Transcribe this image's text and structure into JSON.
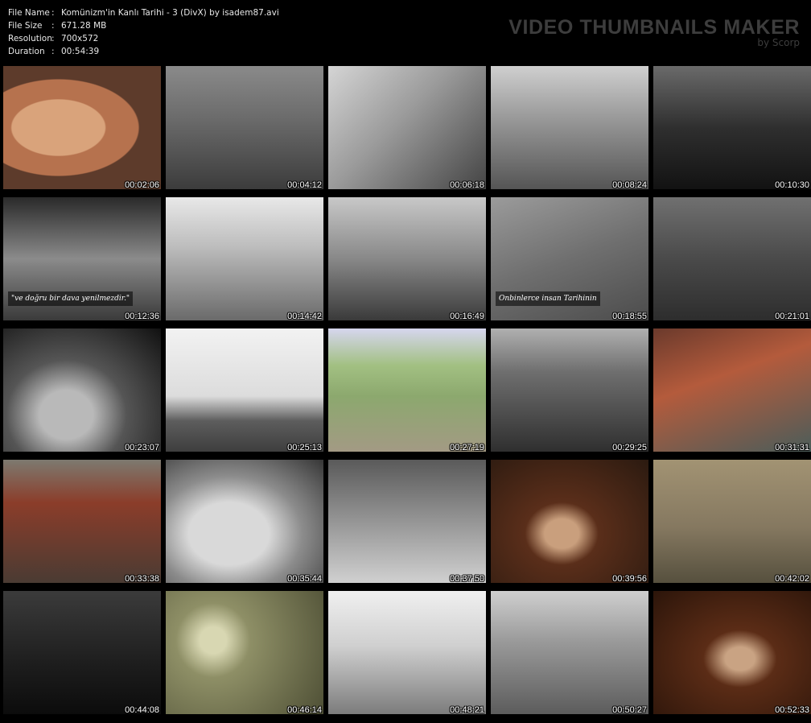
{
  "info": [
    {
      "key": "File Name",
      "sep": ":",
      "value": "Komünizm'in Kanlı Tarihi - 3 (DivX) by isadem87.avi"
    },
    {
      "key": "File Size",
      "sep": ":",
      "value": "671.28 MB"
    },
    {
      "key": "Resolution",
      "sep": ":",
      "value": "700x572"
    },
    {
      "key": "Duration",
      "sep": ":",
      "value": "00:54:39"
    }
  ],
  "brand": {
    "title": "VIDEO THUMBNAILS MAKER",
    "subtitle": "by Scorp"
  },
  "thumbnails": [
    {
      "time": "00:02:06",
      "caption": ""
    },
    {
      "time": "00:04:12",
      "caption": ""
    },
    {
      "time": "00:06:18",
      "caption": ""
    },
    {
      "time": "00:08:24",
      "caption": ""
    },
    {
      "time": "00:10:30",
      "caption": ""
    },
    {
      "time": "00:12:36",
      "caption": "\"ve doğru bir dava yenilmezdir.\""
    },
    {
      "time": "00:14:42",
      "caption": ""
    },
    {
      "time": "00:16:49",
      "caption": ""
    },
    {
      "time": "00:18:55",
      "caption": "Onbinlerce insan Tarihinin"
    },
    {
      "time": "00:21:01",
      "caption": ""
    },
    {
      "time": "00:23:07",
      "caption": ""
    },
    {
      "time": "00:25:13",
      "caption": ""
    },
    {
      "time": "00:27:19",
      "caption": ""
    },
    {
      "time": "00:29:25",
      "caption": ""
    },
    {
      "time": "00:31:31",
      "caption": ""
    },
    {
      "time": "00:33:38",
      "caption": ""
    },
    {
      "time": "00:35:44",
      "caption": ""
    },
    {
      "time": "00:37:50",
      "caption": ""
    },
    {
      "time": "00:39:56",
      "caption": ""
    },
    {
      "time": "00:42:02",
      "caption": ""
    },
    {
      "time": "00:44:08",
      "caption": ""
    },
    {
      "time": "00:46:14",
      "caption": ""
    },
    {
      "time": "00:48:21",
      "caption": ""
    },
    {
      "time": "00:50:27",
      "caption": ""
    },
    {
      "time": "00:52:33",
      "caption": ""
    }
  ]
}
